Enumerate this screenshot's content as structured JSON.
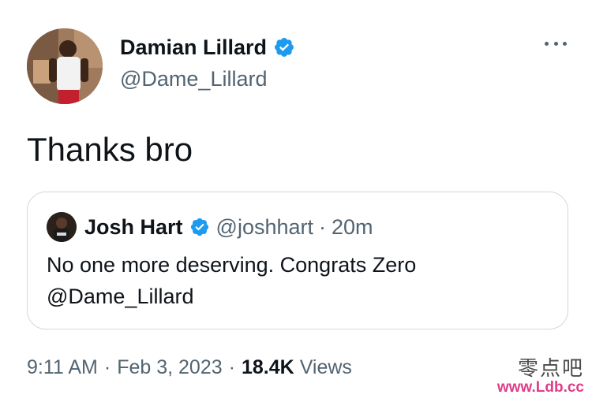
{
  "author": {
    "display_name": "Damian Lillard",
    "handle": "@Dame_Lillard"
  },
  "tweet": {
    "text": "Thanks bro"
  },
  "quoted_tweet": {
    "display_name": "Josh Hart",
    "handle": "@joshhart",
    "separator": "·",
    "time_ago": "20m",
    "text": "No one more deserving. Congrats Zero @Dame_Lillard"
  },
  "meta": {
    "time": "9:11 AM",
    "separator": "·",
    "date": "Feb 3, 2023",
    "views_count": "18.4K",
    "views_label": "Views"
  },
  "watermark": {
    "chinese": "零点吧",
    "url": "www.Ldb.cc"
  },
  "colors": {
    "verified_blue": "#1d9bf0",
    "secondary_text": "#536471",
    "primary_text": "#0f1419",
    "border": "#cfd9de",
    "watermark_url": "#e03c8a"
  },
  "icons": {
    "verified": "verified-badge-icon",
    "more": "more-options-icon"
  }
}
